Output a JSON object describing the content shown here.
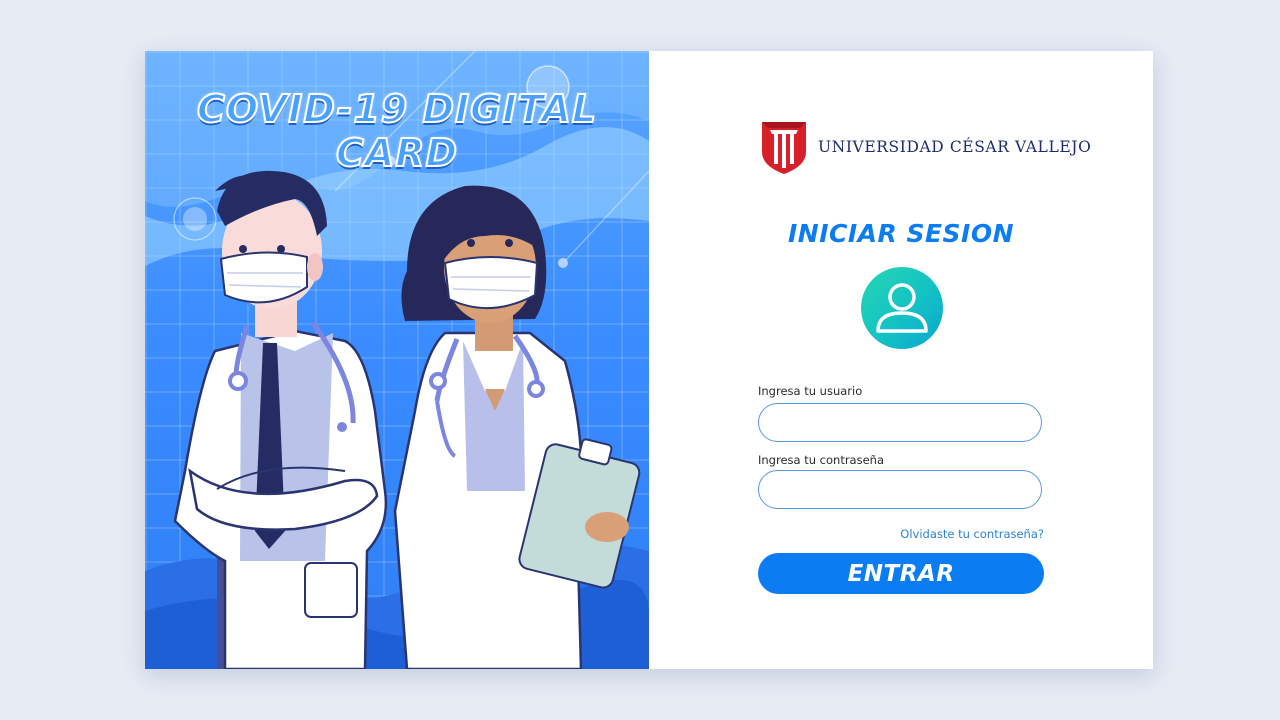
{
  "hero": {
    "title": "COVID-19 DIGITAL CARD",
    "illustration": "doctors-illustration"
  },
  "brand": {
    "name": "UNIVERSIDAD CÉSAR VALLEJO",
    "logo": "ucv-shield-logo"
  },
  "login": {
    "title": "INICIAR SESION",
    "avatar_icon": "user-icon",
    "username_label": "Ingresa tu usuario",
    "username_value": "",
    "password_label": "Ingresa tu contraseña",
    "password_value": "",
    "forgot_label": "Olvidaste tu contraseña?",
    "submit_label": "ENTRAR"
  },
  "colors": {
    "page_bg": "#e6ebf4",
    "hero_blue": "#3a8cff",
    "accent": "#0b7cf2",
    "brand_red": "#d8202a",
    "brand_navy": "#1d2c6b",
    "avatar_green": "#1fcfb6"
  }
}
